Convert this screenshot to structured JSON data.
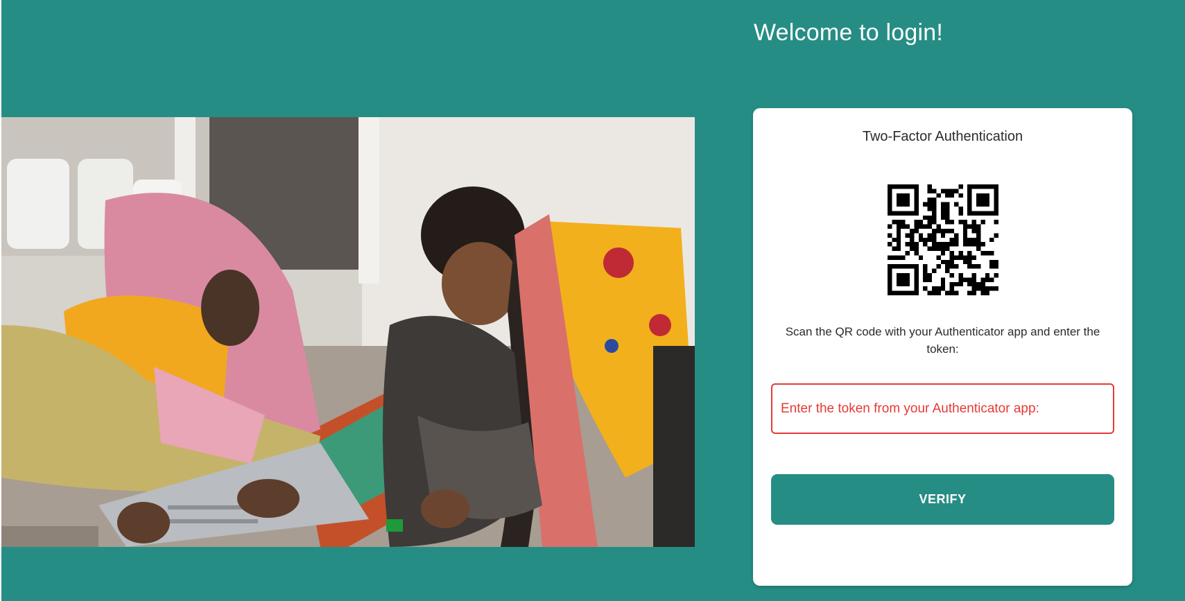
{
  "page": {
    "welcome_title": "Welcome to login!"
  },
  "card": {
    "title": "Two-Factor Authentication",
    "instructions": "Scan the QR code with your Authenticator app and enter the token:",
    "token_placeholder": "Enter the token from your Authenticator app:",
    "token_value": "",
    "verify_label": "VERIFY"
  },
  "colors": {
    "background": "#268d85",
    "accent": "#268d85",
    "card": "#ffffff",
    "error": "#e53935",
    "text": "#2b2b2b"
  },
  "icons": {
    "qr": "qr-code-icon"
  }
}
